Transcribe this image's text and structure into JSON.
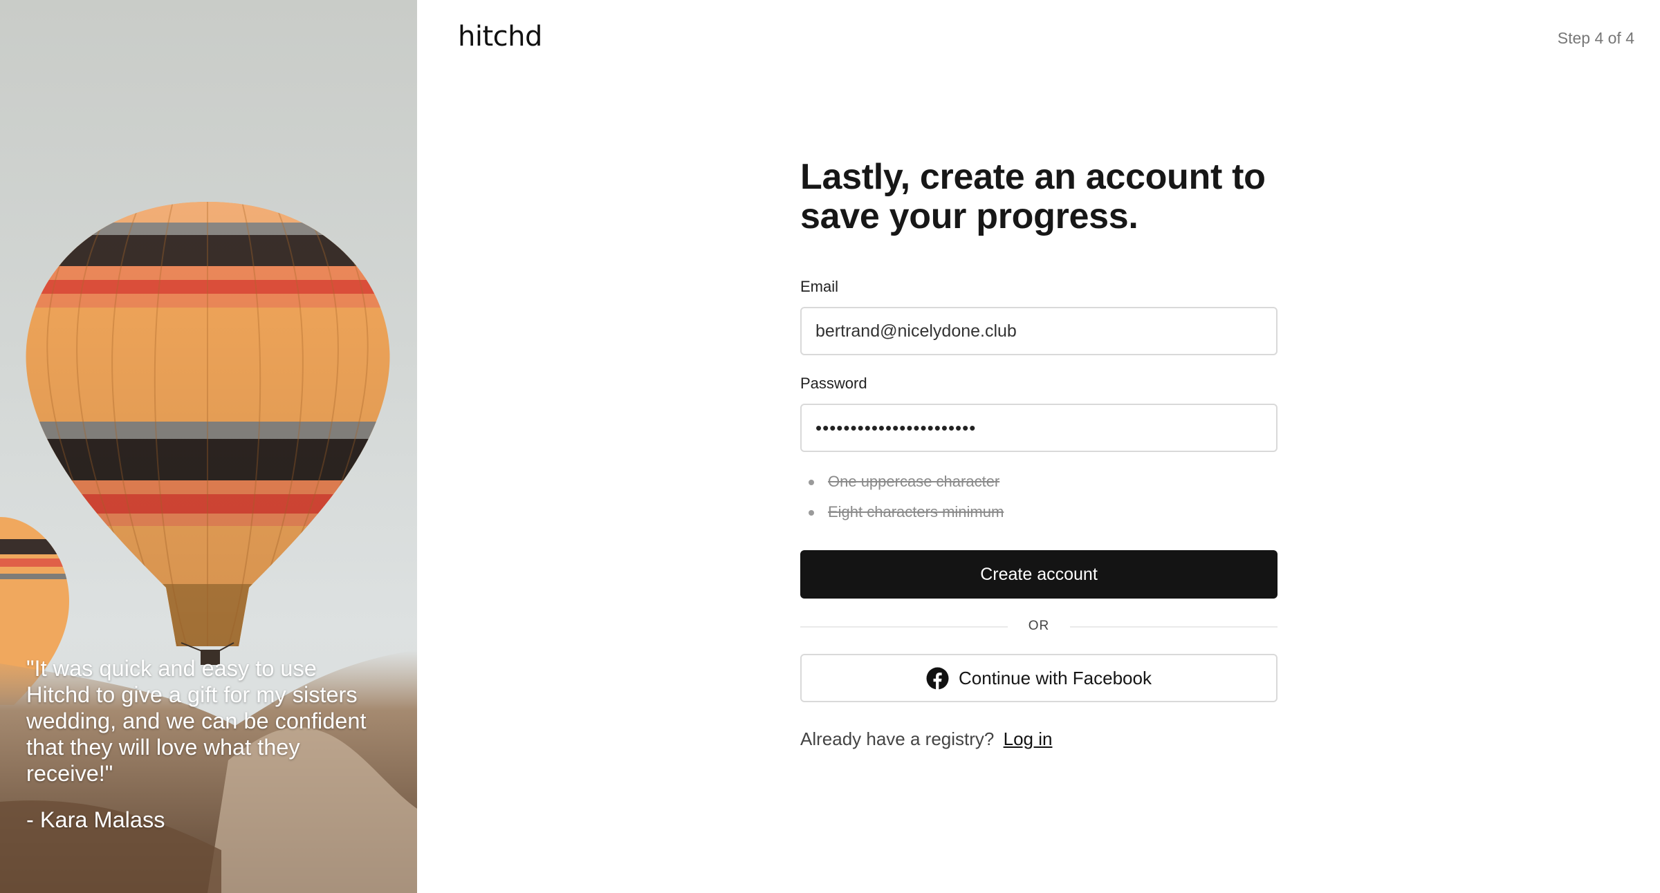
{
  "brand": {
    "logo": "hitchd"
  },
  "header": {
    "step": "Step 4 of 4"
  },
  "testimonial": {
    "quote": "\"It was quick and easy to use Hitchd to give a gift for my sisters wedding, and we can be confident that they will love what they receive!\"",
    "author": "- Kara Malass"
  },
  "form": {
    "title": "Lastly, create an account to save your progress.",
    "email_label": "Email",
    "email_value": "bertrand@nicelydone.club",
    "password_label": "Password",
    "password_value": "•••••••••••••••••••••••",
    "requirements": [
      "One uppercase character",
      "Eight characters minimum"
    ],
    "submit_label": "Create account",
    "divider_label": "OR",
    "facebook_label": "Continue with Facebook",
    "login_prompt": "Already have a registry?",
    "login_link": "Log in"
  },
  "colors": {
    "primary_button": "#141414",
    "border": "#d9d9d9",
    "balloon_orange": "#f2a65a",
    "balloon_stripe_red": "#e05a43"
  },
  "icons": {
    "facebook": "facebook-icon",
    "hero_image": "hot-air-balloon-photo"
  }
}
